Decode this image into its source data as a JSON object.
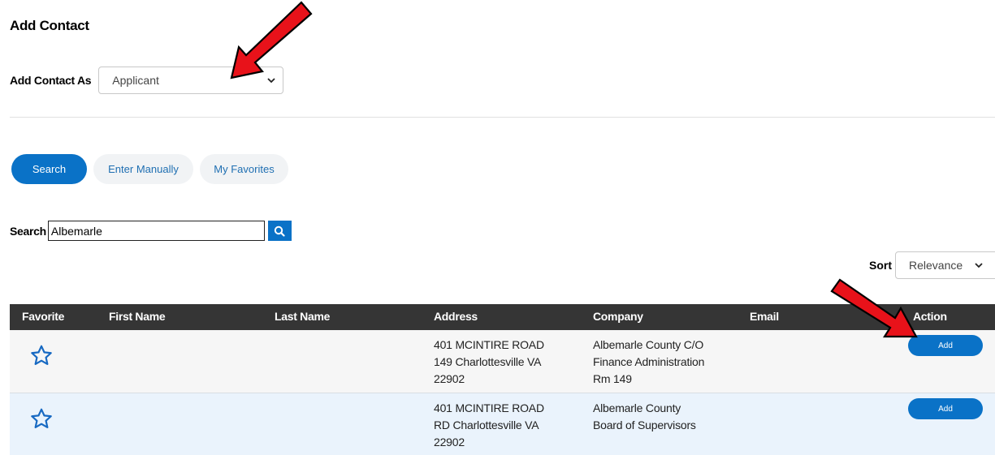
{
  "page": {
    "title": "Add Contact"
  },
  "contact_as": {
    "label": "Add Contact As",
    "selected": "Applicant"
  },
  "tabs": [
    {
      "label": "Search",
      "active": true
    },
    {
      "label": "Enter Manually",
      "active": false
    },
    {
      "label": "My Favorites",
      "active": false
    }
  ],
  "search": {
    "label": "Search",
    "value": "Albemarle"
  },
  "sort": {
    "label": "Sort",
    "selected": "Relevance"
  },
  "table": {
    "headers": [
      "Favorite",
      "First Name",
      "Last Name",
      "Address",
      "Company",
      "Email",
      "Action"
    ],
    "rows": [
      {
        "first_name": "",
        "last_name": "",
        "address": [
          "401 MCINTIRE ROAD",
          "149 Charlottesville VA",
          "22902"
        ],
        "company": [
          "Albemarle County C/O",
          "Finance Administration",
          "Rm 149"
        ],
        "email": "",
        "action": "Add"
      },
      {
        "first_name": "",
        "last_name": "",
        "address": [
          "401 MCINTIRE ROAD",
          "RD Charlottesville VA",
          "22902"
        ],
        "company": [
          "Albemarle County",
          "Board of Supervisors"
        ],
        "email": "",
        "action": "Add"
      }
    ]
  },
  "colors": {
    "accent": "#0a72c7",
    "header_bg": "#353535",
    "annotation_arrow": "#e8121a"
  },
  "icons": {
    "favorite": "star-outline-icon",
    "search": "magnifier-icon",
    "dropdown": "chevron-down-icon"
  }
}
